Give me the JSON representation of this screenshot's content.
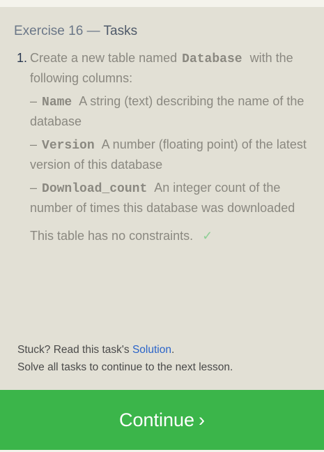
{
  "header": {
    "exercise": "Exercise 16",
    "separator": "—",
    "section": "Tasks"
  },
  "tasks": [
    {
      "number": "1.",
      "intro_before": "Create a new table named",
      "table_name": "Database",
      "intro_after": "with the following columns:",
      "columns": [
        {
          "dash": "–",
          "name": "Name",
          "description": "A string (text) describing the name of the database"
        },
        {
          "dash": "–",
          "name": "Version",
          "description": "A number (floating point) of the latest version of this database"
        },
        {
          "dash": "–",
          "name": "Download_count",
          "description": "An integer count of the number of times this database was downloaded"
        }
      ],
      "constraints_text": "This table has no constraints.",
      "completed_icon": "checkmark-icon",
      "completed_glyph": "✓"
    }
  ],
  "footer": {
    "stuck_prefix": "Stuck? Read this task's",
    "solution_link": "Solution",
    "stuck_suffix": ".",
    "instruction": "Solve all tasks to continue to the next lesson."
  },
  "continue_button": {
    "label": "Continue",
    "chevron": "›"
  },
  "colors": {
    "panel_bg": "#e2e0d5",
    "page_bg": "#f4f3ec",
    "continue_bg": "#3bb54a",
    "link": "#2a63c8",
    "check": "#8fcf96"
  }
}
